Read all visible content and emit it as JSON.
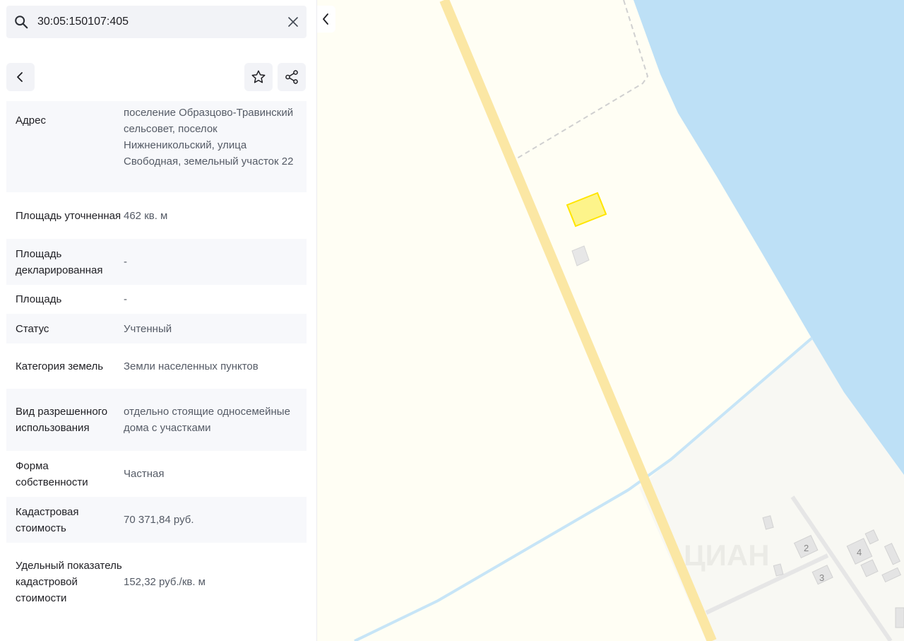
{
  "search": {
    "value": "30:05:150107:405",
    "placeholder": ""
  },
  "properties": [
    {
      "label": "Адрес",
      "value": "поселение Образцово-Травинский сельсовет, поселок Нижненикольский, улица Свободная, земельный участок 22"
    },
    {
      "label": "Площадь уточненная",
      "value": "462 кв. м"
    },
    {
      "label": "Площадь декларированная",
      "value": "-"
    },
    {
      "label": "Площадь",
      "value": "-"
    },
    {
      "label": "Статус",
      "value": "Учтенный"
    },
    {
      "label": "Категория земель",
      "value": "Земли населенных пунктов"
    },
    {
      "label": "Вид разрешенного использования",
      "value": "отдельно стоящие односемейные дома с участками"
    },
    {
      "label": "Форма собственности",
      "value": "Частная"
    },
    {
      "label": "Кадастровая стоимость",
      "value": "70 371,84 руб."
    },
    {
      "label": "Удельный показатель кадастровой стоимости",
      "value": "152,32 руб./кв. м"
    }
  ],
  "map": {
    "house_numbers": [
      "2",
      "3",
      "4"
    ],
    "watermark": "ЦИАН",
    "colors": {
      "land": "#fffef4",
      "water": "#bde0f6",
      "road": "#fbe7a4",
      "plot": "#fdf48a",
      "plot_border": "#ffe500"
    }
  },
  "icons": {
    "search": "search-icon",
    "clear": "close-icon",
    "back": "chevron-left-icon",
    "favorite": "star-icon",
    "share": "share-icon",
    "collapse": "chevron-left-icon"
  }
}
